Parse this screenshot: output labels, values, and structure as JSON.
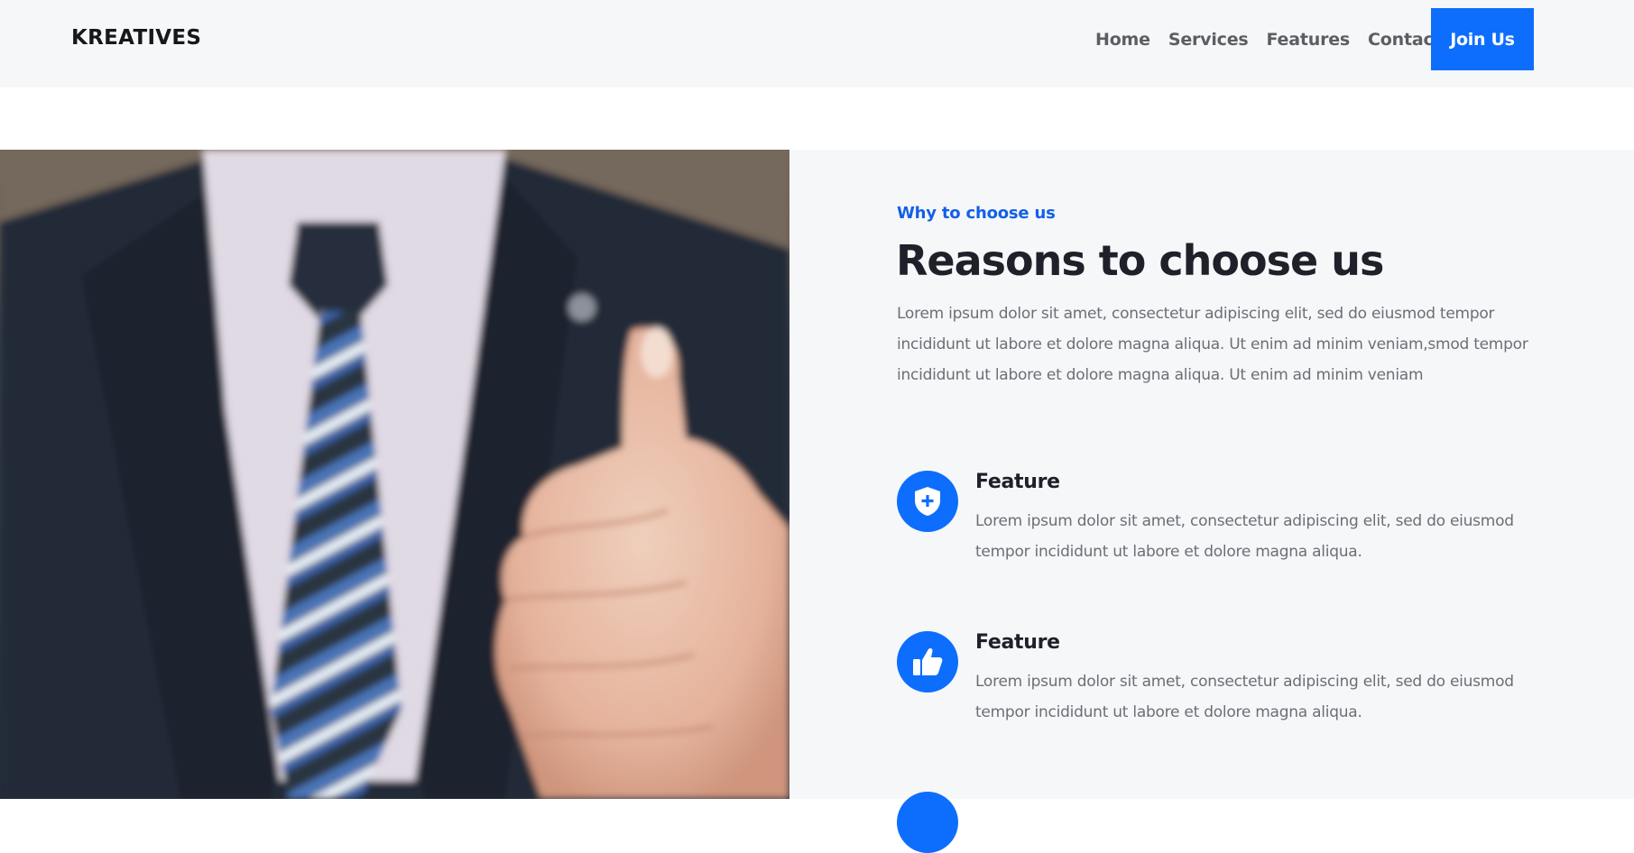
{
  "header": {
    "logo": "KREATIVES",
    "nav": [
      "Home",
      "Services",
      "Features",
      "Contact"
    ],
    "cta": "Join Us"
  },
  "section": {
    "eyebrow": "Why to choose us",
    "title": "Reasons to choose us",
    "lead": "Lorem ipsum dolor sit amet, consectetur adipiscing elit, sed do eiusmod tempor incididunt ut labore et dolore magna aliqua. Ut enim ad minim veniam,smod tempor incididunt ut labore et dolore magna aliqua. Ut enim ad minim veniam",
    "features": [
      {
        "icon": "shield-plus-icon",
        "title": "Feature",
        "text": "Lorem ipsum dolor sit amet, consectetur adipiscing elit, sed do eiusmod tempor incididunt ut labore et dolore magna aliqua."
      },
      {
        "icon": "thumbs-up-icon",
        "title": "Feature",
        "text": "Lorem ipsum dolor sit amet, consectetur adipiscing elit, sed do eiusmod tempor incididunt ut labore et dolore magna aliqua."
      }
    ]
  },
  "colors": {
    "accent": "#0d6efd",
    "heading": "#1f2029",
    "body_text": "#6b6f76",
    "section_bg": "#f6f7f9"
  }
}
